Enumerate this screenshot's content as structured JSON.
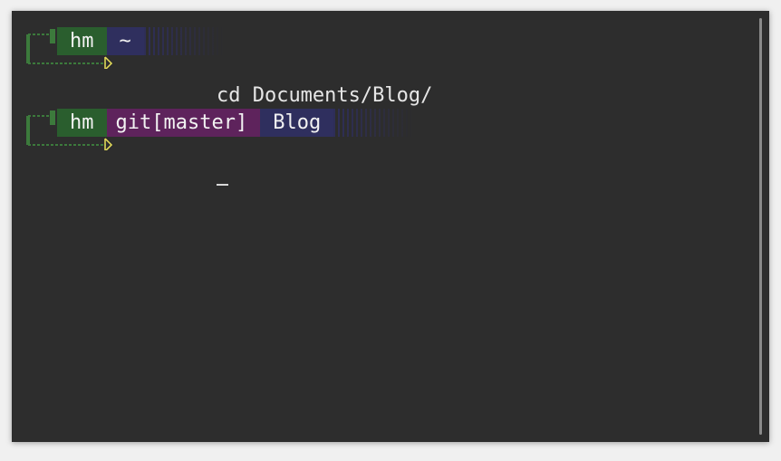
{
  "terminal": {
    "prompts": [
      {
        "user": "hm",
        "directory": "~",
        "git": "",
        "command": "cd Documents/Blog/"
      },
      {
        "user": "hm",
        "directory": "Blog",
        "git": "git[master]",
        "command": ""
      }
    ],
    "colors": {
      "background": "#2d2d2d",
      "user_segment": "#2a5e2e",
      "dir_segment": "#2f2f5e",
      "git_segment": "#5e235c",
      "bracket": "#3c7a3c",
      "arrow": "#e8e05a"
    },
    "cursor_icon": "underscore-cursor"
  }
}
